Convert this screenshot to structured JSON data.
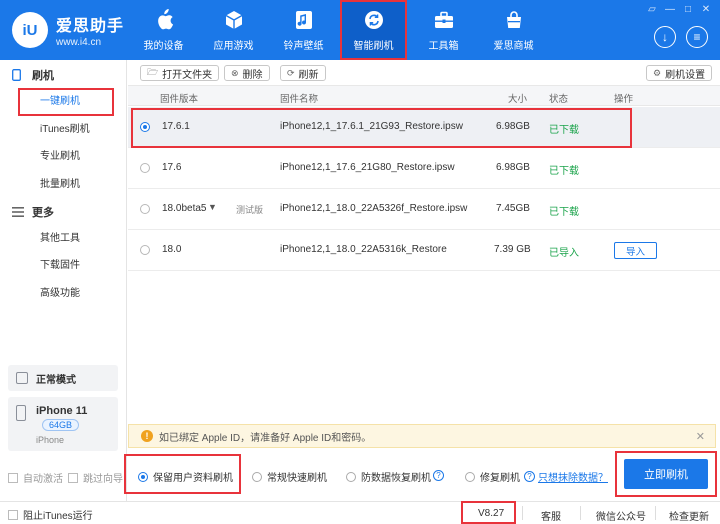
{
  "app": {
    "name": "爱思助手",
    "url": "www.i4.cn",
    "logo_mark": "iU",
    "accent": "#1b78e8",
    "highlight": "#e8333b"
  },
  "window_controls": [
    "shirt-icon",
    "minimize-icon",
    "maximize-icon",
    "close-icon"
  ],
  "nav": [
    {
      "label": "我的设备",
      "icon": "apple-icon"
    },
    {
      "label": "应用游戏",
      "icon": "cube-icon"
    },
    {
      "label": "铃声壁纸",
      "icon": "music-icon"
    },
    {
      "label": "智能刷机",
      "icon": "refresh-shield-icon",
      "active": true
    },
    {
      "label": "工具箱",
      "icon": "toolbox-icon"
    },
    {
      "label": "爱思商城",
      "icon": "bag-icon"
    }
  ],
  "sidebar": {
    "sections": [
      {
        "title": "刷机",
        "items": [
          "一键刷机",
          "iTunes刷机",
          "专业刷机",
          "批量刷机"
        ]
      },
      {
        "title": "更多",
        "items": [
          "其他工具",
          "下载固件",
          "高级功能"
        ]
      }
    ],
    "mode": "正常模式",
    "device": {
      "name": "iPhone 11",
      "storage": "64GB",
      "type": "iPhone"
    }
  },
  "toolbar": {
    "open_folder": "打开文件夹",
    "delete": "删除",
    "refresh": "刷新",
    "settings": "刷机设置"
  },
  "table": {
    "headers": {
      "version": "固件版本",
      "name": "固件名称",
      "size": "大小",
      "status": "状态",
      "action": "操作"
    },
    "rows": [
      {
        "version": "17.6.1",
        "name": "iPhone12,1_17.6.1_21G93_Restore.ipsw",
        "size": "6.98GB",
        "status": "已下载",
        "selected": true
      },
      {
        "version": "17.6",
        "name": "iPhone12,1_17.6_21G80_Restore.ipsw",
        "size": "6.98GB",
        "status": "已下载"
      },
      {
        "version": "18.0beta5",
        "tag": "测试版",
        "name": "iPhone12,1_18.0_22A5326f_Restore.ipsw",
        "size": "7.45GB",
        "status": "已下载"
      },
      {
        "version": "18.0",
        "name": "iPhone12,1_18.0_22A5316k_Restore",
        "size": "7.39 GB",
        "status": "已导入",
        "action": "导入"
      }
    ]
  },
  "notice": "如已绑定 Apple ID，请准备好 Apple ID和密码。",
  "bottom": {
    "auto_activate": "自动激活",
    "skip_guide": "跳过向导",
    "options": [
      "保留用户资料刷机",
      "常规快速刷机",
      "防数据恢复刷机",
      "修复刷机"
    ],
    "erase_link": "只想抹除数据？",
    "flash_button": "立即刷机"
  },
  "statusbar": {
    "block_itunes": "阻止iTunes运行",
    "version": "V8.27",
    "support": "客服",
    "wechat": "微信公众号",
    "check_update": "检查更新"
  }
}
